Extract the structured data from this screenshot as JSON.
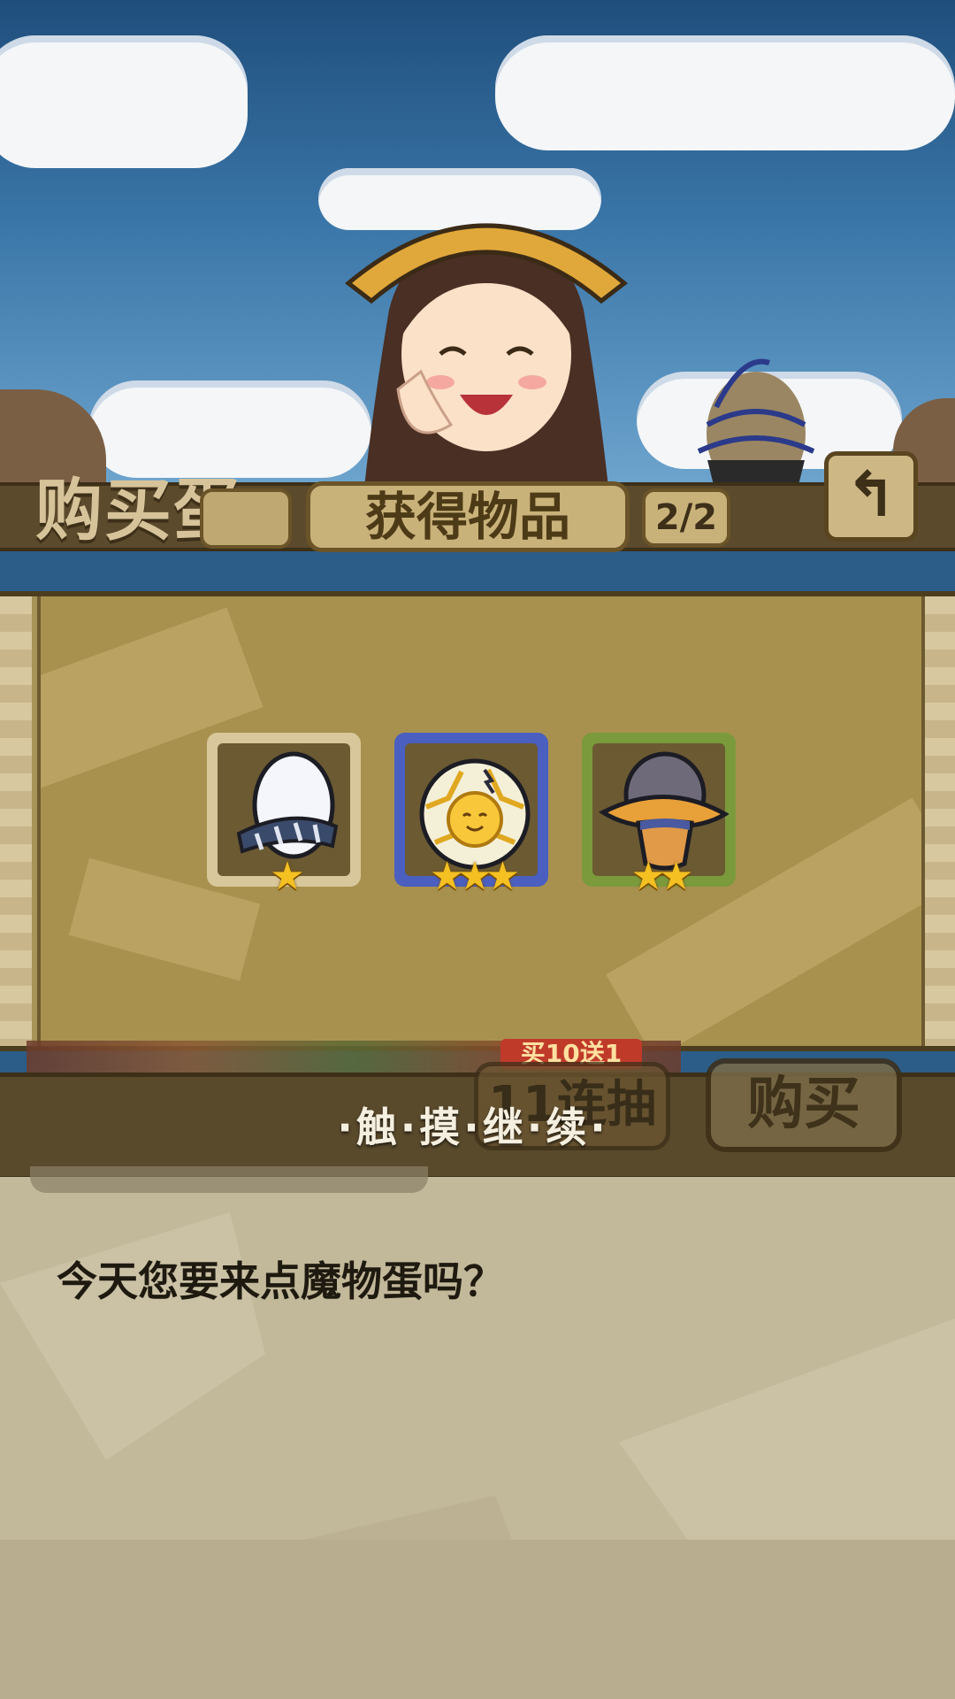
{
  "header": {
    "shop_title": "购买蛋",
    "panel_title": "获得物品",
    "page_count": "2/2",
    "back_icon": "back-arrow-icon"
  },
  "rewards": [
    {
      "name": "white-striped-egg",
      "frame_color": "#d8c79a",
      "stars": 1,
      "stars_text": "★"
    },
    {
      "name": "golden-sun-egg",
      "frame_color": "#4a5fc0",
      "stars": 3,
      "stars_text": "★★★"
    },
    {
      "name": "gray-hat-egg",
      "frame_color": "#7a9a3c",
      "stars": 2,
      "stars_text": "★★"
    }
  ],
  "bottom": {
    "touch_continue": "·触·摸·继·续·",
    "eleven_draw": "11连抽",
    "ten_bonus": "买10送1",
    "buy": "购买"
  },
  "dialog": {
    "text": "今天您要来点魔物蛋吗？"
  }
}
